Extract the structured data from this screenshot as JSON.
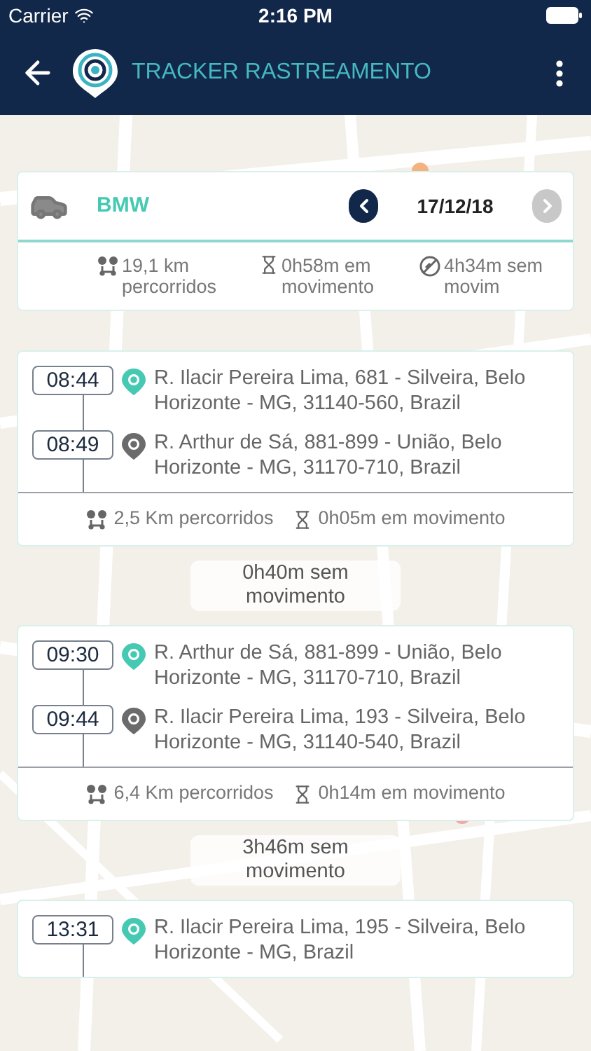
{
  "status_bar": {
    "carrier": "Carrier",
    "time": "2:16 PM"
  },
  "header": {
    "title": "TRACKER RASTREAMENTO"
  },
  "vehicle": {
    "name": "BMW",
    "date": "17/12/18",
    "prev_disabled": false,
    "next_disabled": true,
    "stats": [
      {
        "kind": "distance",
        "text": "19,1 km percorridos"
      },
      {
        "kind": "moving",
        "text": "0h58m em movimento"
      },
      {
        "kind": "stopped",
        "text": "4h34m sem movim"
      }
    ]
  },
  "timeline": [
    {
      "kind": "trip",
      "stops": [
        {
          "kind": "start",
          "time": "08:44",
          "address": "R. Ilacir Pereira Lima, 681 - Silveira, Belo Horizonte - MG, 31140-560, Brazil"
        },
        {
          "kind": "end",
          "time": "08:49",
          "address": "R. Arthur de Sá, 881-899 - União, Belo Horizonte - MG, 31170-710, Brazil"
        }
      ],
      "distance": "2,5 Km percorridos",
      "moving": "0h05m em movimento"
    },
    {
      "kind": "idle",
      "text": "0h40m sem movimento"
    },
    {
      "kind": "trip",
      "stops": [
        {
          "kind": "start",
          "time": "09:30",
          "address": "R. Arthur de Sá, 881-899 - União, Belo Horizonte - MG, 31170-710, Brazil"
        },
        {
          "kind": "end",
          "time": "09:44",
          "address": "R. Ilacir Pereira Lima, 193 - Silveira, Belo Horizonte - MG, 31140-540, Brazil"
        }
      ],
      "distance": "6,4 Km percorridos",
      "moving": "0h14m em movimento"
    },
    {
      "kind": "idle",
      "text": "3h46m sem movimento"
    },
    {
      "kind": "trip",
      "stops": [
        {
          "kind": "start",
          "time": "13:31",
          "address": "R. Ilacir Pereira Lima, 195 - Silveira, Belo Horizonte - MG, Brazil"
        }
      ]
    }
  ]
}
